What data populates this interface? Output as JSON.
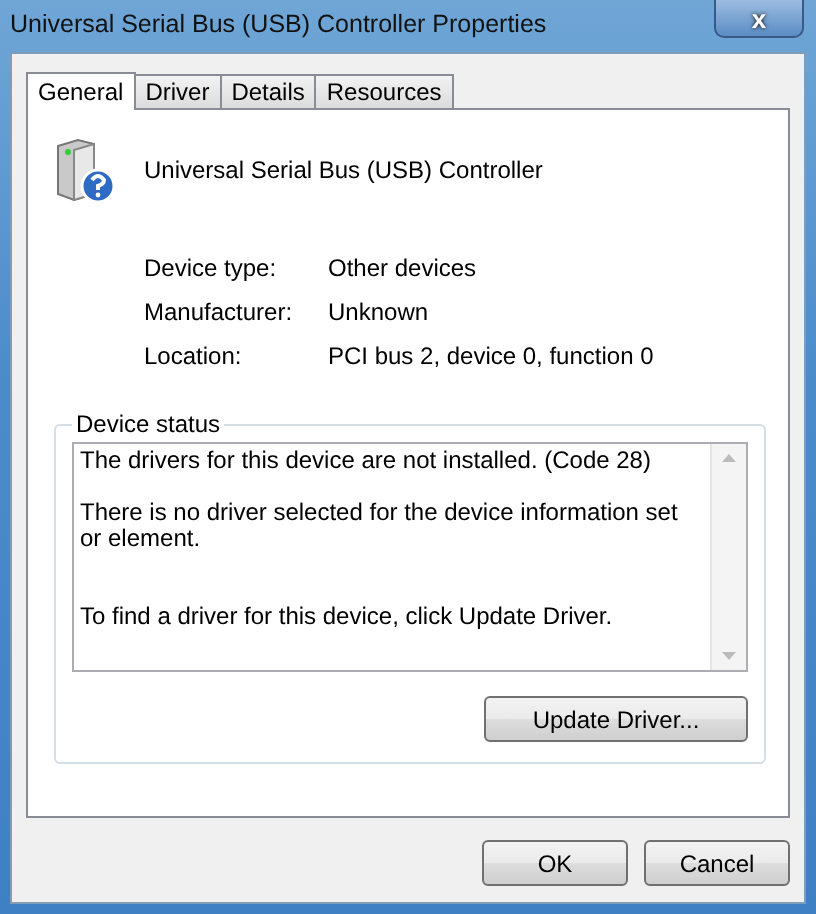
{
  "window": {
    "title": "Universal Serial Bus (USB) Controller Properties",
    "close": "x"
  },
  "tabs": [
    {
      "label": "General",
      "selected": true
    },
    {
      "label": "Driver",
      "selected": false
    },
    {
      "label": "Details",
      "selected": false
    },
    {
      "label": "Resources",
      "selected": false
    }
  ],
  "device": {
    "name": "Universal Serial Bus (USB) Controller"
  },
  "properties": [
    {
      "label": "Device type:",
      "value": "Other devices"
    },
    {
      "label": "Manufacturer:",
      "value": "Unknown"
    },
    {
      "label": "Location:",
      "value": "PCI bus 2, device 0, function 0"
    }
  ],
  "device_status": {
    "title": "Device status",
    "text": "The drivers for this device are not installed. (Code 28)\n\nThere is no driver selected for the device information set or element.\n\n\nTo find a driver for this device, click Update Driver.",
    "button": "Update Driver..."
  },
  "buttons": [
    "OK",
    "Cancel"
  ]
}
